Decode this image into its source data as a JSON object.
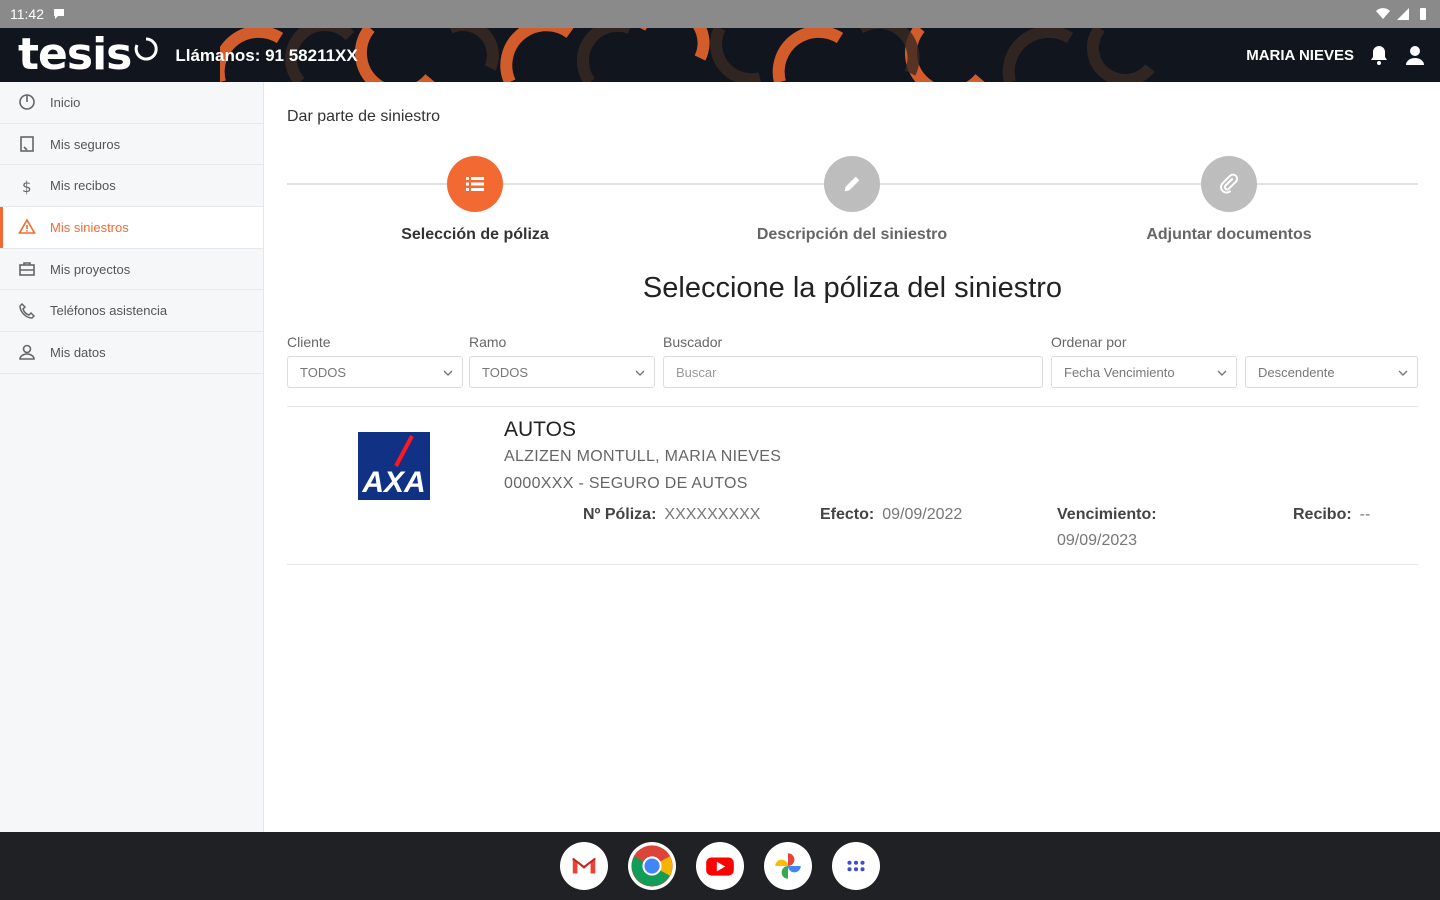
{
  "status_bar": {
    "time": "11:42"
  },
  "header": {
    "logo": "tesis",
    "phone": "Llámanos: 91 58211XX",
    "user": "MARIA NIEVES"
  },
  "sidebar": {
    "items": [
      {
        "label": "Inicio",
        "icon": "pie-chart-icon"
      },
      {
        "label": "Mis seguros",
        "icon": "document-icon"
      },
      {
        "label": "Mis recibos",
        "icon": "dollar-icon"
      },
      {
        "label": "Mis siniestros",
        "icon": "warning-icon",
        "active": true
      },
      {
        "label": "Mis proyectos",
        "icon": "briefcase-icon"
      },
      {
        "label": "Teléfonos asistencia",
        "icon": "phone-icon"
      },
      {
        "label": "Mis datos",
        "icon": "user-icon"
      }
    ]
  },
  "main": {
    "page_title": "Dar parte de siniestro",
    "steps": [
      {
        "label": "Selección de póliza",
        "icon": "list-icon",
        "active": true
      },
      {
        "label": "Descripción del siniestro",
        "icon": "pencil-icon"
      },
      {
        "label": "Adjuntar documentos",
        "icon": "paperclip-icon"
      }
    ],
    "section_title": "Seleccione la póliza del siniestro",
    "filters": {
      "cliente": {
        "label": "Cliente",
        "value": "TODOS"
      },
      "ramo": {
        "label": "Ramo",
        "value": "TODOS"
      },
      "buscador": {
        "label": "Buscador",
        "placeholder": "Buscar"
      },
      "ordenar": {
        "label": "Ordenar por",
        "value": "Fecha Vencimiento",
        "direction": "Descendente"
      }
    },
    "policy": {
      "insurer_logo": "AXA",
      "type": "AUTOS",
      "holder": "ALZIZEN MONTULL, MARIA NIEVES",
      "product": "0000XXX - SEGURO DE AUTOS",
      "poliza_label": "Nº Póliza:",
      "poliza_value": "XXXXXXXXX",
      "efecto_label": "Efecto:",
      "efecto_value": "09/09/2022",
      "vencimiento_label": "Vencimiento:",
      "vencimiento_value": "09/09/2023",
      "recibo_label": "Recibo:",
      "recibo_value": "--"
    }
  },
  "dock": {
    "apps": [
      "gmail-icon",
      "chrome-icon",
      "youtube-icon",
      "photos-icon",
      "app-drawer-icon"
    ]
  },
  "colors": {
    "accent": "#f26a32",
    "header_bg": "#10151e",
    "status_bar": "#8a8a8a",
    "dock": "#202124",
    "axa_blue": "#103184",
    "axa_red": "#ff1721"
  }
}
